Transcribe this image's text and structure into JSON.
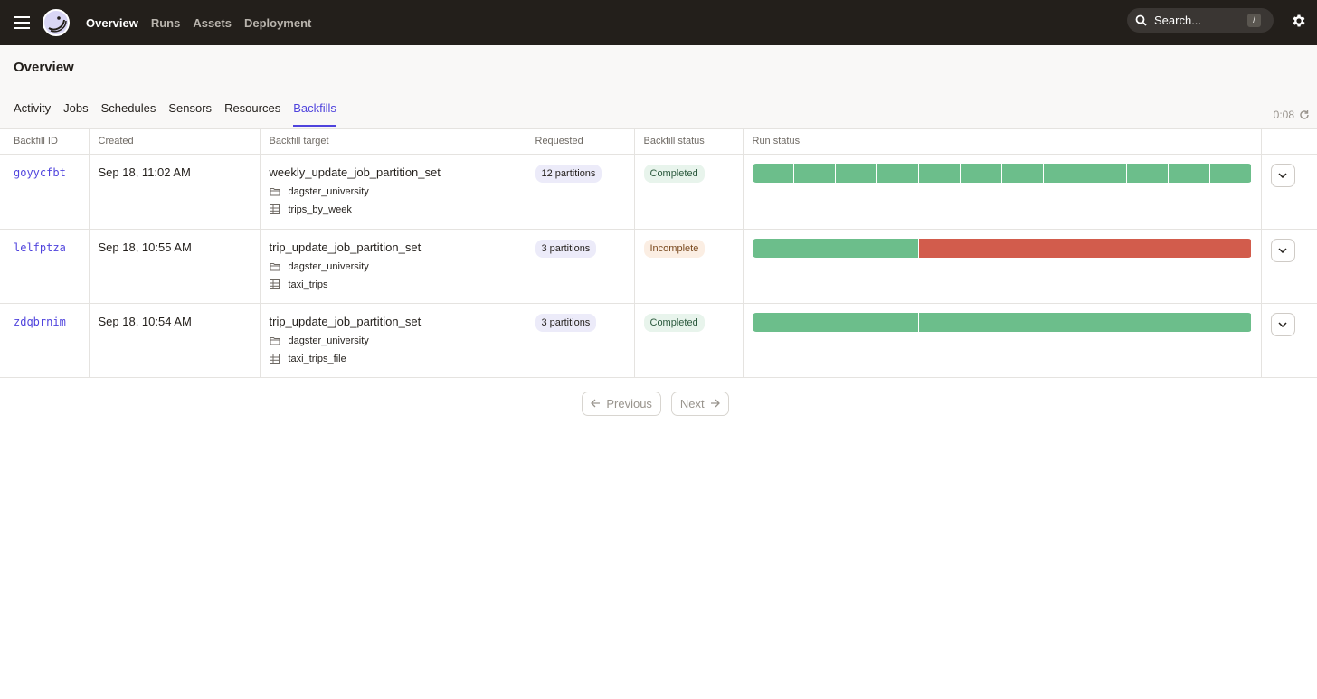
{
  "nav": {
    "links": [
      "Overview",
      "Runs",
      "Assets",
      "Deployment"
    ],
    "active": "Overview",
    "search_placeholder": "Search...",
    "search_shortcut": "/"
  },
  "page": {
    "title": "Overview",
    "tabs": [
      "Activity",
      "Jobs",
      "Schedules",
      "Sensors",
      "Resources",
      "Backfills"
    ],
    "active_tab": "Backfills",
    "refresh_timer": "0:08"
  },
  "table": {
    "headers": [
      "Backfill ID",
      "Created",
      "Backfill target",
      "Requested",
      "Backfill status",
      "Run status"
    ],
    "rows": [
      {
        "id": "goyycfbt",
        "created": "Sep 18, 11:02 AM",
        "target": "weekly_update_job_partition_set",
        "location": "dagster_university",
        "asset": "trips_by_week",
        "requested": "12 partitions",
        "status": "Completed",
        "run_segments": [
          "success",
          "success",
          "success",
          "success",
          "success",
          "success",
          "success",
          "success",
          "success",
          "success",
          "success",
          "success"
        ]
      },
      {
        "id": "lelfptza",
        "created": "Sep 18, 10:55 AM",
        "target": "trip_update_job_partition_set",
        "location": "dagster_university",
        "asset": "taxi_trips",
        "requested": "3 partitions",
        "status": "Incomplete",
        "run_segments": [
          "success",
          "failure",
          "failure"
        ]
      },
      {
        "id": "zdqbrnim",
        "created": "Sep 18, 10:54 AM",
        "target": "trip_update_job_partition_set",
        "location": "dagster_university",
        "asset": "taxi_trips_file",
        "requested": "3 partitions",
        "status": "Completed",
        "run_segments": [
          "success",
          "success",
          "success"
        ]
      }
    ]
  },
  "pagination": {
    "previous": "Previous",
    "next": "Next"
  },
  "colors": {
    "accent": "#4f43dd",
    "success": "#6cbe8b",
    "failure": "#d25c4c",
    "nav_bg": "#231f1b"
  }
}
